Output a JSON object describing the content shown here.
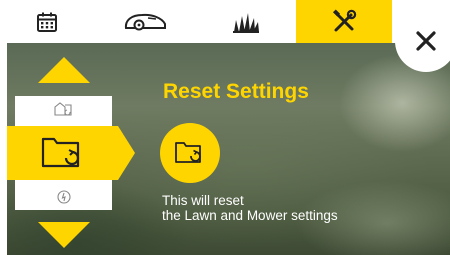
{
  "tabs": [
    {
      "icon": "calendar-icon",
      "active": false
    },
    {
      "icon": "mower-icon",
      "active": false
    },
    {
      "icon": "grass-icon",
      "active": false
    },
    {
      "icon": "tools-icon",
      "active": true
    }
  ],
  "close": {
    "icon": "close-icon"
  },
  "menu": {
    "up_icon": "arrow-up-icon",
    "down_icon": "arrow-down-icon",
    "items": [
      {
        "icon": "lawn-reset-icon",
        "selected": false
      },
      {
        "icon": "folder-reset-icon",
        "selected": true
      },
      {
        "icon": "factory-reset-icon",
        "selected": false
      }
    ]
  },
  "content": {
    "title": "Reset Settings",
    "action_icon": "folder-reset-icon",
    "description_line1": "This will reset",
    "description_line2": "the Lawn and Mower settings"
  },
  "colors": {
    "accent": "#ffd500",
    "text_light": "#ffffff",
    "icon_dark": "#222222"
  }
}
